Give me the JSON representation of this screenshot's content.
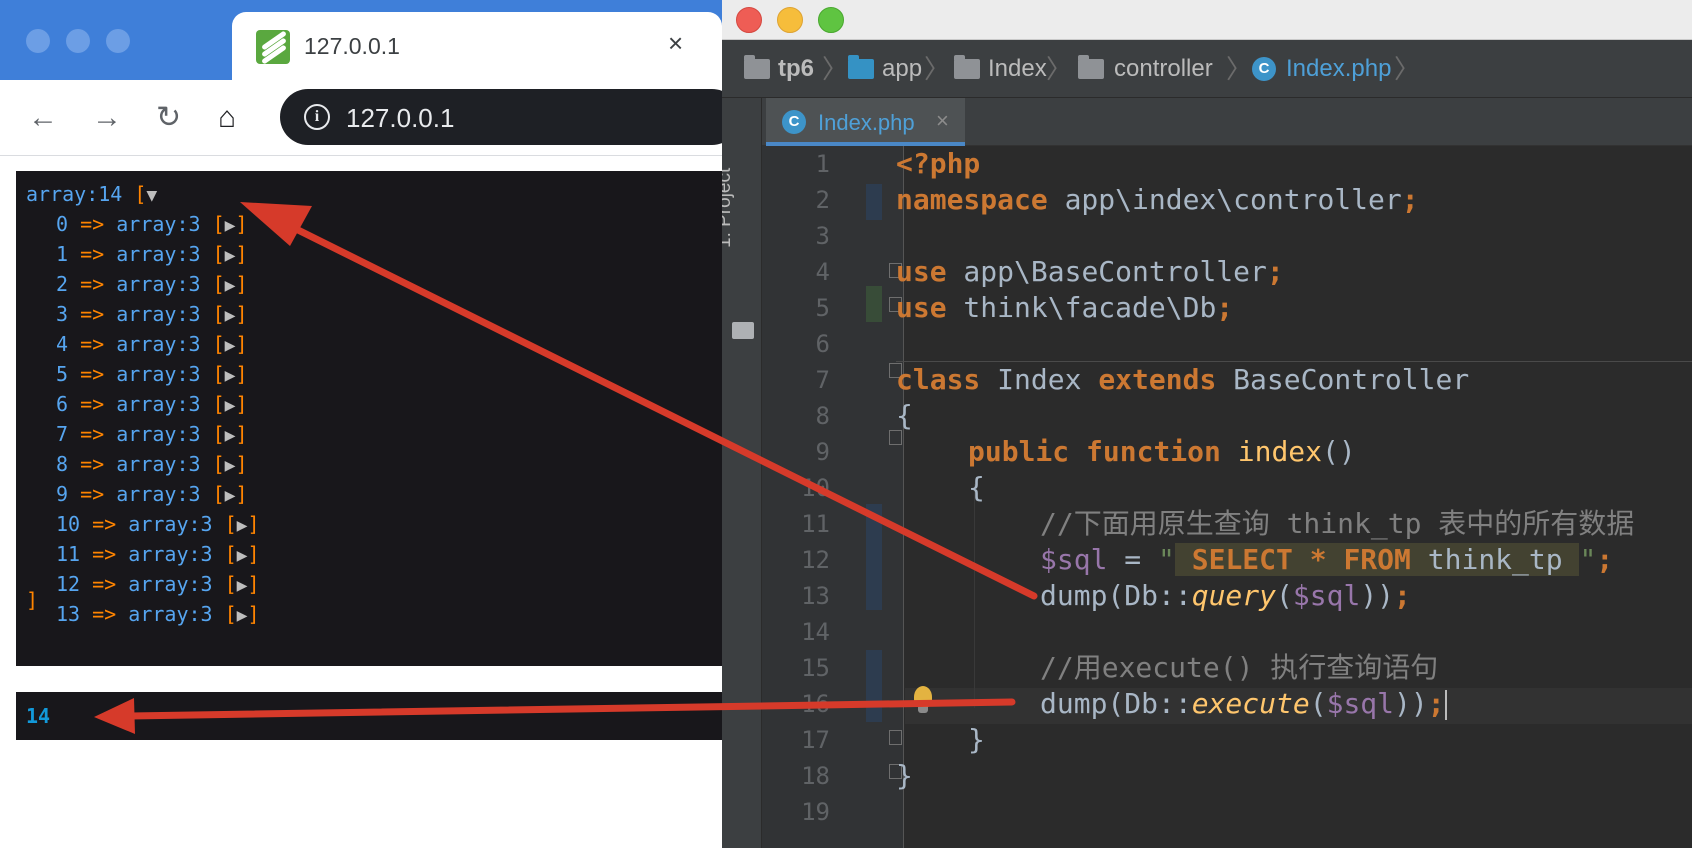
{
  "browser": {
    "tab_title": "127.0.0.1",
    "tab_close": "×",
    "url": "127.0.0.1",
    "info_glyph": "i",
    "nav": {
      "back": "←",
      "forward": "→",
      "reload": "↻",
      "home": "⌂"
    },
    "dump1": {
      "header_label": "array:14",
      "header_bracket": "[",
      "header_toggle": "▼",
      "items": [
        {
          "index": "0",
          "arrow": "=>",
          "label": "array:3"
        },
        {
          "index": "1",
          "arrow": "=>",
          "label": "array:3"
        },
        {
          "index": "2",
          "arrow": "=>",
          "label": "array:3"
        },
        {
          "index": "3",
          "arrow": "=>",
          "label": "array:3"
        },
        {
          "index": "4",
          "arrow": "=>",
          "label": "array:3"
        },
        {
          "index": "5",
          "arrow": "=>",
          "label": "array:3"
        },
        {
          "index": "6",
          "arrow": "=>",
          "label": "array:3"
        },
        {
          "index": "7",
          "arrow": "=>",
          "label": "array:3"
        },
        {
          "index": "8",
          "arrow": "=>",
          "label": "array:3"
        },
        {
          "index": "9",
          "arrow": "=>",
          "label": "array:3"
        },
        {
          "index": "10",
          "arrow": "=>",
          "label": "array:3"
        },
        {
          "index": "11",
          "arrow": "=>",
          "label": "array:3"
        },
        {
          "index": "12",
          "arrow": "=>",
          "label": "array:3"
        },
        {
          "index": "13",
          "arrow": "=>",
          "label": "array:3"
        }
      ],
      "item_open": "[",
      "item_toggle": "▶",
      "item_close": "]",
      "footer": "]"
    },
    "dump2": {
      "value": "14"
    }
  },
  "ide": {
    "breadcrumb": [
      "tp6",
      "app",
      "Index",
      "controller",
      "Index.php"
    ],
    "breadcrumb_sep": "〉",
    "class_glyph": "C",
    "tab": {
      "label": "Index.php",
      "close": "×"
    },
    "sidebar": {
      "project_label": "1: Project"
    },
    "line_numbers": [
      "1",
      "2",
      "3",
      "4",
      "5",
      "6",
      "7",
      "8",
      "9",
      "10",
      "11",
      "12",
      "13",
      "14",
      "15",
      "16",
      "17",
      "18",
      "19"
    ],
    "code": {
      "l1": "<?php",
      "l2_kw": "namespace",
      "l2_rest": " app\\index\\controller",
      "l2_semi": ";",
      "l4_kw": "use",
      "l4_rest": " app\\BaseController",
      "l4_semi": ";",
      "l5_kw": "use",
      "l5_rest": " think\\facade\\Db",
      "l5_semi": ";",
      "l7_kw1": "class",
      "l7_name": " Index ",
      "l7_kw2": "extends",
      "l7_base": " BaseController",
      "l8": "{",
      "l9_kw1": "public",
      "l9_kw2": "function",
      "l9_fn": "index",
      "l9_parens": "()",
      "l10": "{",
      "l11": "//下面用原生查询 think_tp 表中的所有数据",
      "l12_var": "$sql",
      "l12_eq": " = ",
      "l12_q1": "\"",
      "l12_sel": " SELECT * FROM",
      "l12_tbl": " think_tp ",
      "l12_q2": "\"",
      "l12_semi": ";",
      "l13_a": "dump(Db::",
      "l13_fn": "query",
      "l13_b": "(",
      "l13_var": "$sql",
      "l13_c": "))",
      "l13_semi": ";",
      "l15": "//用execute() 执行查询语句",
      "l16_a": "dump(Db::",
      "l16_fn": "execute",
      "l16_b": "(",
      "l16_var": "$sql",
      "l16_c": "))",
      "l16_semi": ";",
      "l17": "}",
      "l18": "}"
    }
  },
  "colors": {
    "annotation_arrow": "#d63a2a",
    "keyword": "#cc7832",
    "string": "#6a8759",
    "variable": "#9876aa",
    "dump_blue": "#56a5f0",
    "dump_orange": "#ff8400"
  }
}
